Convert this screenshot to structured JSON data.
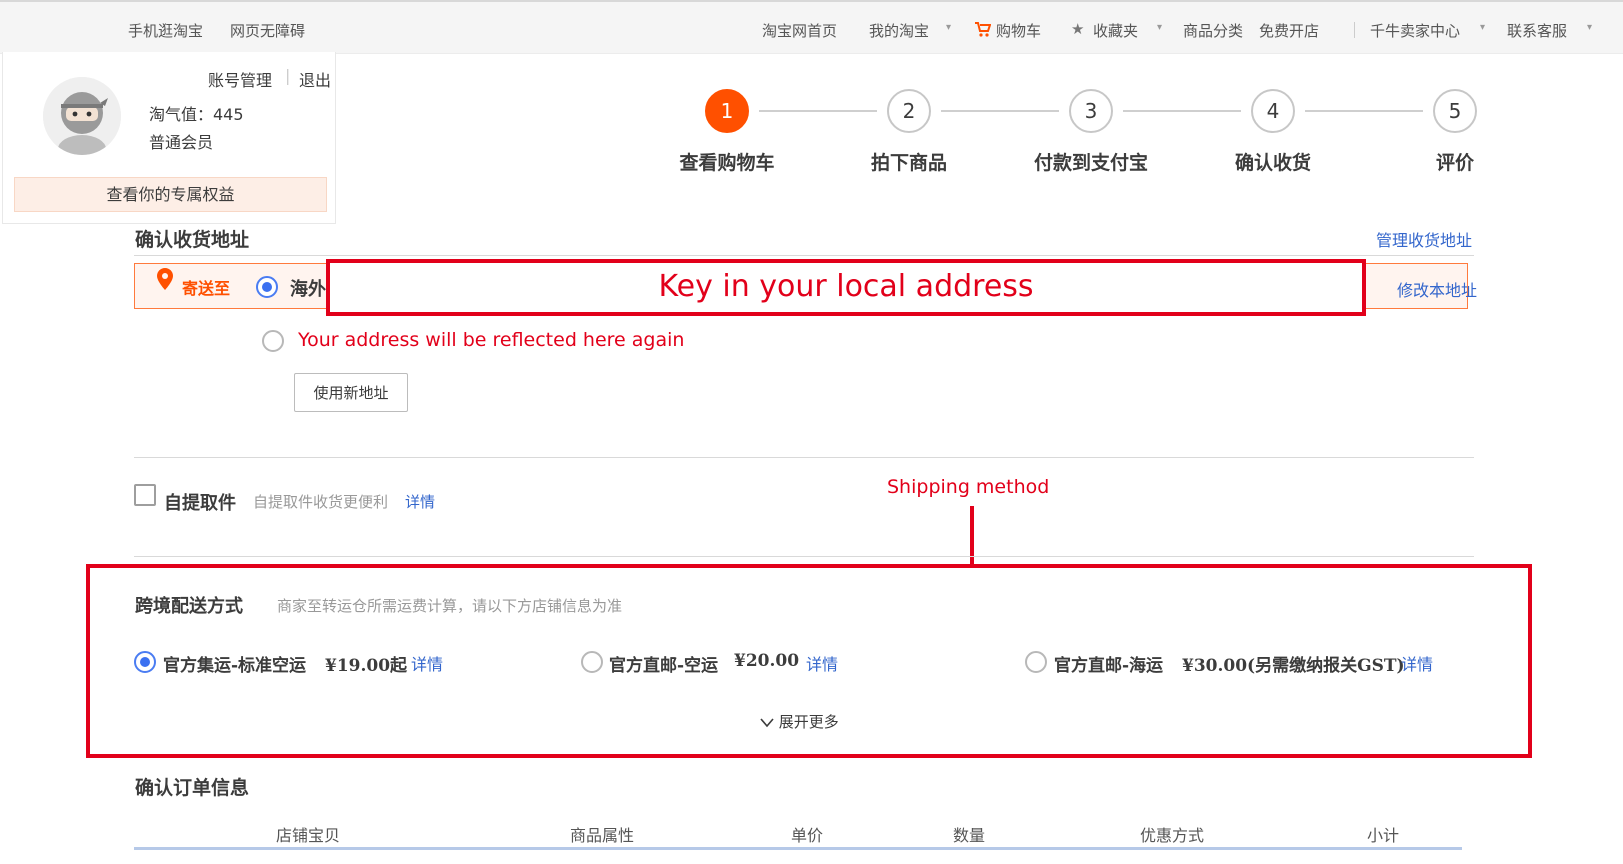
{
  "topbar": {
    "left_links": [
      "手机逛淘宝",
      "网页无障碍"
    ],
    "right_links": {
      "home": "淘宝网首页",
      "my_taobao": "我的淘宝",
      "cart": "购物车",
      "favorites": "收藏夹",
      "categories": "商品分类",
      "open_store": "免费开店",
      "seller_center": "千牛卖家中心",
      "contact": "联系客服"
    }
  },
  "user_card": {
    "account_manage": "账号管理",
    "separator": "|",
    "logout": "退出",
    "taoqi_value": "淘气值：445",
    "member_level": "普通会员",
    "benefits_link": "查看你的专属权益"
  },
  "stepper": {
    "steps": [
      {
        "num": "1",
        "label": "查看购物车"
      },
      {
        "num": "2",
        "label": "拍下商品"
      },
      {
        "num": "3",
        "label": "付款到支付宝"
      },
      {
        "num": "4",
        "label": "确认收货"
      },
      {
        "num": "5",
        "label": "评价"
      }
    ],
    "active_step": 1
  },
  "address": {
    "title": "确认收货地址",
    "manage_link": "管理收货地址",
    "ship_to": "寄送至",
    "selected_prefix": "海外",
    "edit_link": "修改本地址",
    "new_address_button": "使用新地址"
  },
  "annotations": {
    "address_box": "Key in your local address",
    "address_reflected": "Your address will be reflected here again",
    "shipping_method": "Shipping method"
  },
  "pickup": {
    "label": "自提取件",
    "description": "自提取件收货更便利",
    "detail": "详情"
  },
  "shipping": {
    "title": "跨境配送方式",
    "subtitle": "商家至转运仓所需运费计算，请以下方店铺信息为准",
    "options": [
      {
        "name": "官方集运-标准空运",
        "price": "¥19.00起",
        "detail": "详情",
        "selected": true
      },
      {
        "name": "官方直邮-空运",
        "price": "¥20.00",
        "detail": "详情",
        "selected": false
      },
      {
        "name": "官方直邮-海运",
        "price": "¥30.00(另需缴纳报关GST)",
        "detail": "详情",
        "selected": false
      }
    ],
    "expand": "展开更多"
  },
  "order": {
    "title": "确认订单信息",
    "columns": [
      "店铺宝贝",
      "商品属性",
      "单价",
      "数量",
      "优惠方式",
      "小计"
    ]
  },
  "colors": {
    "accent": "#ff5000",
    "annotation_red": "#e2001a",
    "link_blue": "#3366cc",
    "radio_blue": "#3b70f0"
  }
}
